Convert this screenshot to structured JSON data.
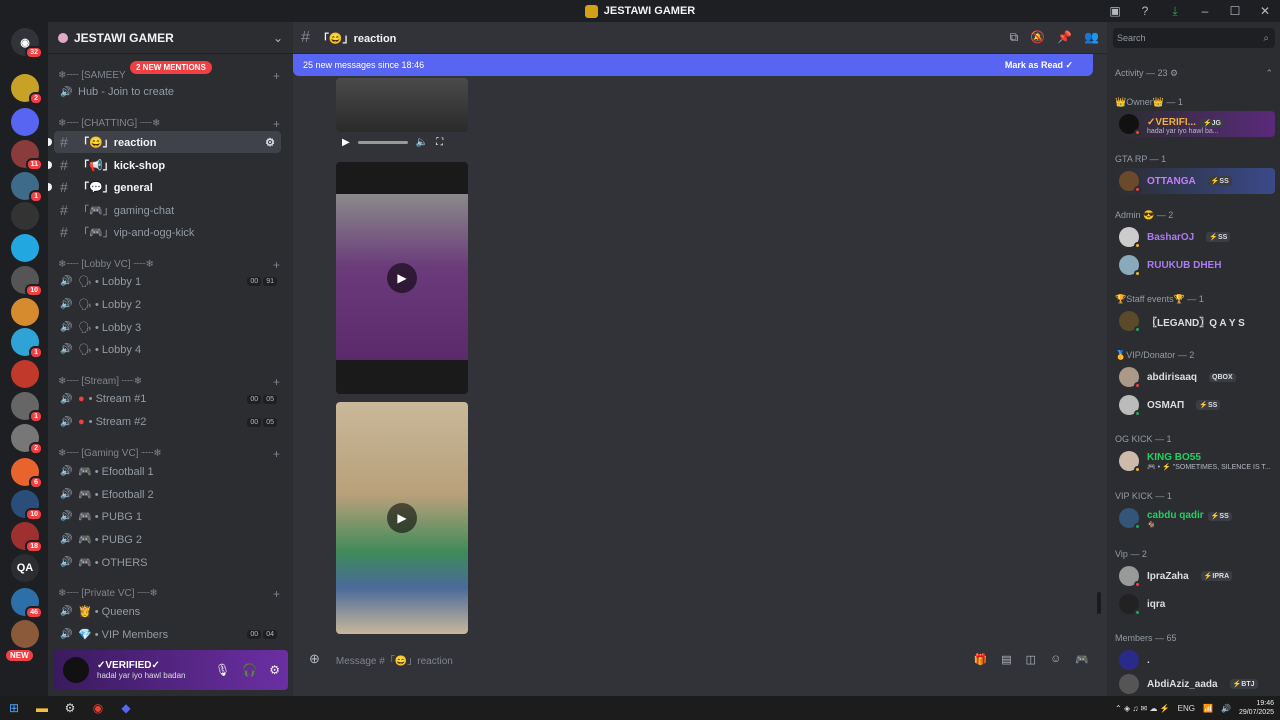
{
  "window": {
    "title": "JESTAWI GAMER"
  },
  "servers": {
    "home_badge": "32",
    "items": [
      {
        "color": "#c8a227",
        "badge": "2"
      },
      {
        "color": "#5865f2",
        "badge": ""
      },
      {
        "color": "#8a3b3b",
        "badge": "11"
      },
      {
        "color": "#3f6b8a",
        "badge": "1"
      },
      {
        "color": "#333333",
        "badge": ""
      },
      {
        "color": "#23a7e0",
        "badge": ""
      },
      {
        "color": "#555555",
        "badge": "10"
      },
      {
        "color": "#d68b2f",
        "badge": ""
      },
      {
        "color": "#2fa3d6",
        "badge": "1"
      },
      {
        "color": "#c0392b",
        "badge": ""
      },
      {
        "color": "#666666",
        "badge": "1"
      },
      {
        "color": "#777777",
        "badge": "2"
      },
      {
        "color": "#e8642c",
        "badge": "6"
      },
      {
        "color": "#2a4d7a",
        "badge": "10"
      },
      {
        "color": "#a03030",
        "badge": "18"
      },
      {
        "color": "#2b2d31",
        "badge": ""
      },
      {
        "color": "#2d6fa8",
        "badge": "46"
      },
      {
        "color": "#8a5a3a",
        "badge": ""
      }
    ],
    "qa_label": "QA",
    "new_label": "NEW"
  },
  "guild": {
    "name": "JESTAWI GAMER",
    "mentions": "2 NEW MENTIONS"
  },
  "channels": {
    "cat1": "❄┈┈ [SAMEEY",
    "hub": "Hub - Join to create",
    "cat_chatting": "❄┈┈ [CHATTING] ┈┈❄",
    "text": [
      {
        "name": "「😄」reaction"
      },
      {
        "name": "「📢」kick-shop"
      },
      {
        "name": "「💬」general"
      },
      {
        "name": "「🎮」gaming-chat"
      },
      {
        "name": "「🎮」vip-and-ogg-kick"
      }
    ],
    "cat_lobby": "❄┈┈ [Lobby VC] ┈┈❄",
    "lobby": [
      {
        "name": "🗣 • Lobby 1",
        "c1": "00",
        "c2": "91"
      },
      {
        "name": "🗣 • Lobby 2"
      },
      {
        "name": "🗣 • Lobby 3"
      },
      {
        "name": "🗣 • Lobby 4"
      }
    ],
    "cat_stream": "❄┈┈ [Stream] ┈┈❄",
    "stream": [
      {
        "name": "• Stream #1",
        "c1": "00",
        "c2": "05"
      },
      {
        "name": "• Stream #2",
        "c1": "00",
        "c2": "05"
      }
    ],
    "cat_gaming": "❄┈┈ [Gaming VC] ┈┈❄",
    "gaming": [
      {
        "name": "🎮 • Efootball 1"
      },
      {
        "name": "🎮 • Efootball 2"
      },
      {
        "name": "🎮 • PUBG 1"
      },
      {
        "name": "🎮 • PUBG 2"
      },
      {
        "name": "🎮 • OTHERS"
      }
    ],
    "cat_private": "❄┈┈ [Private VC] ┈┈❄",
    "private": [
      {
        "name": "👸 • Queens"
      },
      {
        "name": "💎 • VIP Members",
        "c1": "00",
        "c2": "04"
      }
    ]
  },
  "user": {
    "name": "✓VERIFIED✓",
    "status": "hadal yar iyo hawl badan"
  },
  "main": {
    "channel_title": "「😄」reaction",
    "new_messages": "25 new messages since 18:46",
    "mark_read": "Mark as Read",
    "composer_placeholder": "Message #「😄」reaction"
  },
  "members": {
    "search_placeholder": "Search",
    "activity": "Activity — 23",
    "groups": {
      "owner": "👑Owner👑 — 1",
      "gtarp": "GTA RP — 1",
      "admin": "Admin 😎 — 2",
      "staff": "🏆Staff events🏆 — 1",
      "vip_donator": "🥇VIP/Donator — 2",
      "ogkick": "OG KICK — 1",
      "vipkick": "VIP KICK — 1",
      "vip": "Vip — 2",
      "members": "Members — 65"
    },
    "list": {
      "owner_name": "✓VERIFI...",
      "owner_tag": "⚡JG",
      "owner_sub": "hadal yar iyo hawl ba...",
      "ottanga": "OTTANGA",
      "ottanga_tag": "⚡SS",
      "bashar": "BasharOJ",
      "bashar_tag": "⚡SS",
      "ruukub": "RUUKUB DHEH",
      "legand": "〖LEGAND〗Q A Y S",
      "abdirisaaq": "abdirisaaq",
      "abdirisaaq_tag": "QBOX",
      "osmani": "OSMAΠ",
      "osmani_tag": "⚡SS",
      "kingboss": "KING BO55",
      "kingboss_sub": "🎮 • ⚡ \"SOMETIMES, SILENCE IS T...",
      "cabdu": "cabdu qadir",
      "cabdu_tag": "⚡SS",
      "cabdu_sub": "🐐",
      "ipra": "IpraZaha",
      "ipra_tag": "⚡IPRA",
      "iqra": "iqra",
      "dot": ".",
      "abdiaziz": "AbdiAziz_aada",
      "abdiaziz_tag": "⚡BTJ"
    }
  },
  "taskbar": {
    "lang": "ENG",
    "time": "19:46",
    "date": "29/07/2025"
  }
}
